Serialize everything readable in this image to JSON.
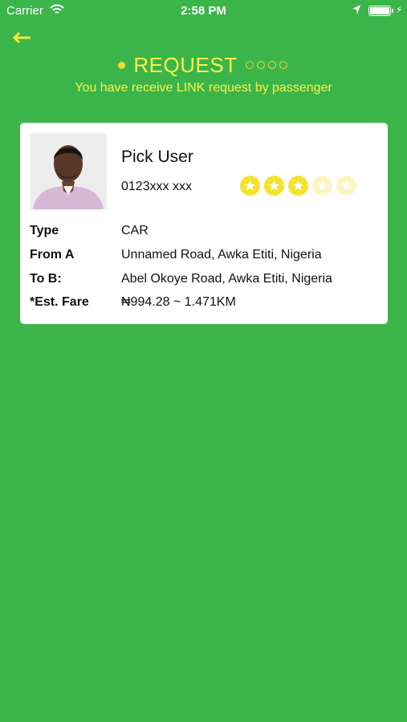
{
  "status_bar": {
    "carrier": "Carrier",
    "time": "2:58 PM"
  },
  "header": {
    "title": "REQUEST",
    "subtitle": "You have receive LINK request by passenger"
  },
  "user": {
    "name": "Pick User",
    "phone": "0123xxx xxx",
    "rating": 3,
    "rating_max": 5
  },
  "details": [
    {
      "label": "Type",
      "value": "CAR"
    },
    {
      "label": "From A",
      "value": "Unnamed Road, Awka Etiti, Nigeria"
    },
    {
      "label": "To B:",
      "value": "Abel Okoye Road, Awka Etiti, Nigeria"
    },
    {
      "label": "*Est. Fare",
      "value": "₦994.28 ~ 1.471KM"
    }
  ],
  "colors": {
    "background": "#3bb54a",
    "accent_yellow": "#fff04a",
    "star_on": "#f5e22d",
    "star_off": "#fbf6c2"
  },
  "icons": [
    "wifi-icon",
    "location-arrow-icon",
    "battery-icon",
    "charging-icon",
    "back-arrow-icon",
    "star-icon"
  ]
}
